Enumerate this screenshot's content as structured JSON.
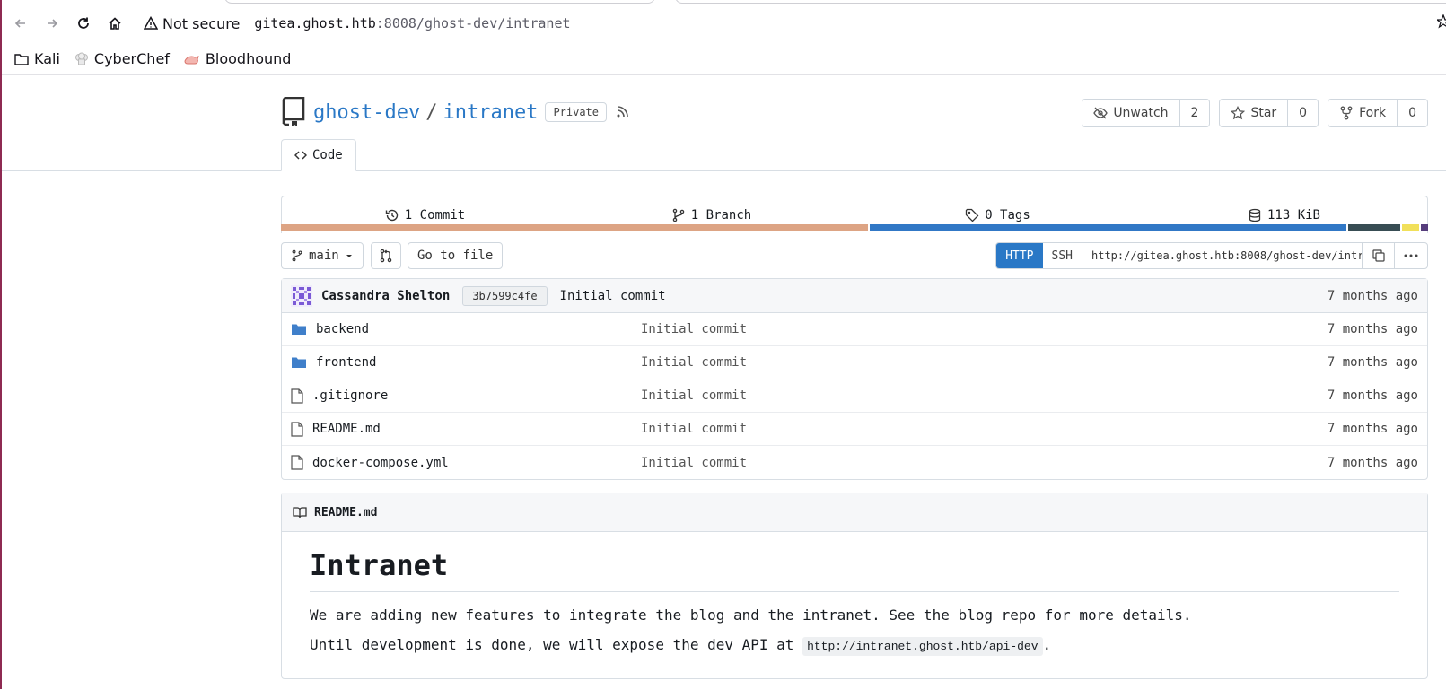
{
  "browser": {
    "security_label": "Not secure",
    "url_host": "gitea.ghost.htb",
    "url_rest": ":8008/ghost-dev/intranet",
    "bookmarks": [
      {
        "label": "Kali",
        "icon": "folder-icon"
      },
      {
        "label": "CyberChef",
        "icon": "chef-hat-icon"
      },
      {
        "label": "Bloodhound",
        "icon": "bloodhound-icon"
      }
    ]
  },
  "repo": {
    "owner": "ghost-dev",
    "name": "intranet",
    "visibility": "Private",
    "unwatch_label": "Unwatch",
    "watch_count": "2",
    "star_label": "Star",
    "star_count": "0",
    "fork_label": "Fork",
    "fork_count": "0",
    "code_tab": "Code"
  },
  "stats": {
    "commits": "1 Commit",
    "branches": "1 Branch",
    "tags": "0 Tags",
    "size": "113 KiB"
  },
  "langbar_colors": [
    "#dda484",
    "#3178c6",
    "#384d54",
    "#f1e05a",
    "#563d7c"
  ],
  "langbar_fractions": [
    0.515,
    0.418,
    0.046,
    0.015,
    0.006
  ],
  "controls": {
    "branch": "main",
    "go_to_file": "Go to file",
    "http_label": "HTTP",
    "ssh_label": "SSH",
    "clone_url": "http://gitea.ghost.htb:8008/ghost-dev/intr"
  },
  "latest_commit": {
    "author": "Cassandra Shelton",
    "sha": "3b7599c4fe",
    "message": "Initial commit",
    "time": "7 months ago"
  },
  "files": [
    {
      "name": "backend",
      "type": "folder",
      "commit": "Initial commit",
      "time": "7 months ago"
    },
    {
      "name": "frontend",
      "type": "folder",
      "commit": "Initial commit",
      "time": "7 months ago"
    },
    {
      "name": ".gitignore",
      "type": "file",
      "commit": "Initial commit",
      "time": "7 months ago"
    },
    {
      "name": "README.md",
      "type": "file",
      "commit": "Initial commit",
      "time": "7 months ago"
    },
    {
      "name": "docker-compose.yml",
      "type": "file",
      "commit": "Initial commit",
      "time": "7 months ago"
    }
  ],
  "readme": {
    "filename": "README.md",
    "title": "Intranet",
    "para1": "We are adding new features to integrate the blog and the intranet. See the blog repo for more details.",
    "para2_prefix": "Until development is done, we will expose the dev API at",
    "para2_code": "http://intranet.ghost.htb/api-dev",
    "para2_suffix": "."
  }
}
